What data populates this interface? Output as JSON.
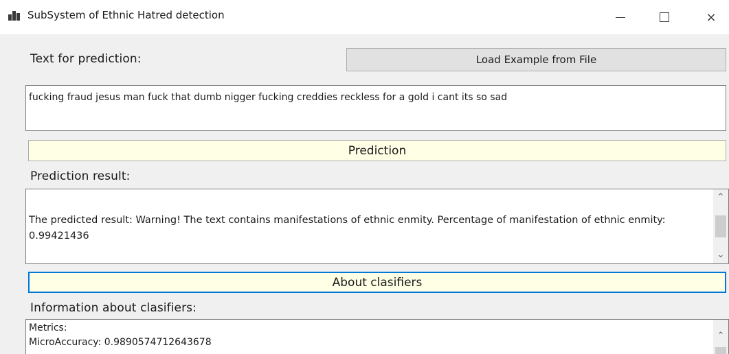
{
  "window": {
    "title": "SubSystem of Ethnic Hatred detection",
    "icon": "app-bars-icon",
    "controls": {
      "minimize": "minimize-icon",
      "maximize": "maximize-icon",
      "close": "×"
    }
  },
  "input_section": {
    "label": "Text for prediction:",
    "load_button": "Load Example from File",
    "text_value": "fucking fraud jesus man fuck that dumb nigger fucking creddies reckless for a gold i cant its so sad"
  },
  "prediction": {
    "button": "Prediction",
    "result_label": "Prediction result:",
    "result_text": "The predicted result: Warning! The text contains manifestations of ethnic enmity. Percentage of manifestation of ethnic enmity: 0.99421436",
    "scroll_up": "⌃",
    "scroll_down": "⌄"
  },
  "classifiers": {
    "button": "About clasifiers",
    "info_label": "Information about clasifiers:",
    "info_lines": [
      "Metrics:",
      "MicroAccuracy: 0.9890574712643678"
    ],
    "scroll_up": "⌃"
  },
  "colors": {
    "accent_focus": "#0078d7",
    "yellow_button": "#ffffe6",
    "client_bg": "#f0f0f0"
  }
}
